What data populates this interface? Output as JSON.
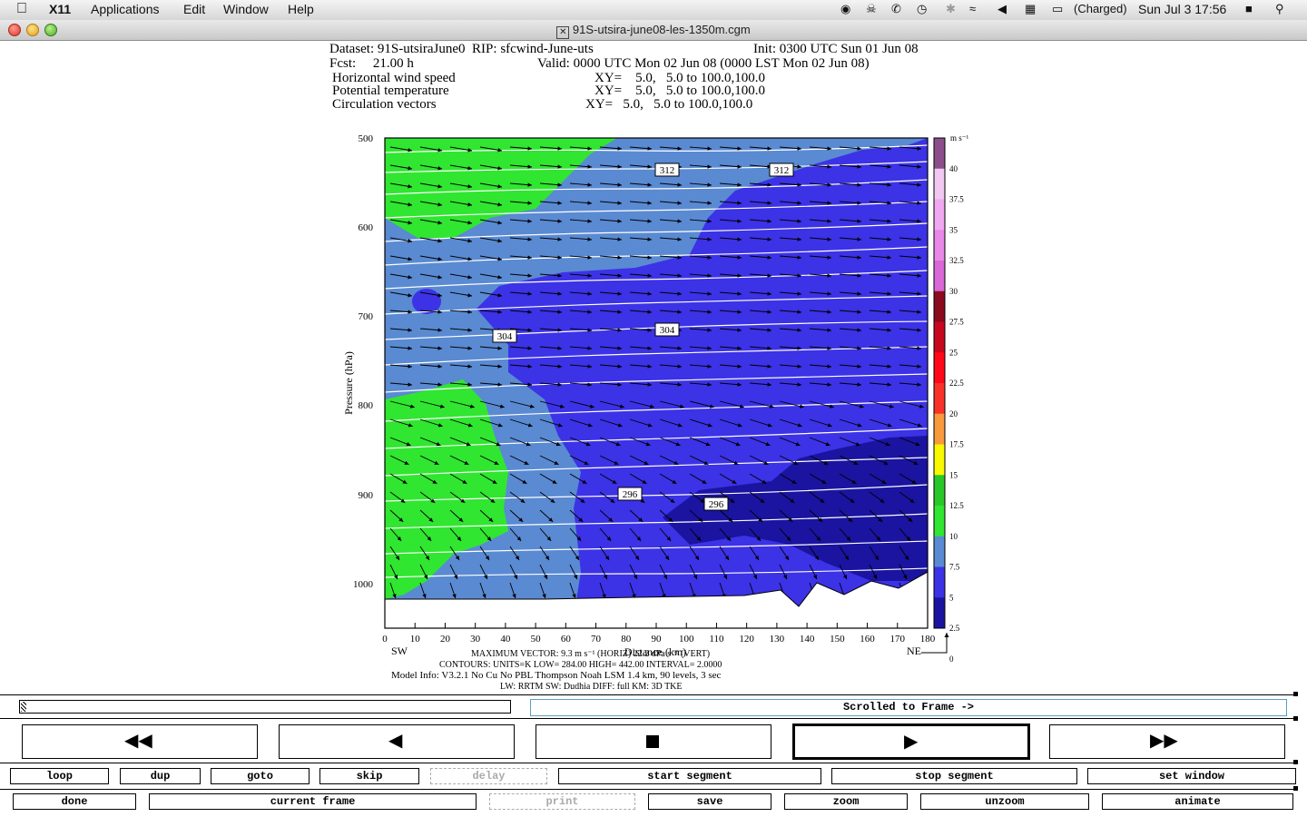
{
  "menubar": {
    "app": "X11",
    "items": [
      "Applications",
      "Edit",
      "Window",
      "Help"
    ],
    "battery": "(Charged)",
    "clock": "Sun Jul 3  17:56"
  },
  "window": {
    "title": "91S-utsira-june08-les-1350m.cgm"
  },
  "header": {
    "line1_left": "Dataset: 91S-utsiraJune0  RIP: sfcwind-June-uts",
    "line1_right": "Init: 0300 UTC Sun 01 Jun 08",
    "line2_left": "Fcst:     21.00 h",
    "line2_right": "Valid: 0000 UTC Mon 02 Jun 08 (0000 LST Mon 02 Jun 08)",
    "fields": [
      {
        "name": "Horizontal wind speed",
        "xy": "XY=    5.0,   5.0 to 100.0,100.0"
      },
      {
        "name": "Potential temperature",
        "xy": "XY=    5.0,   5.0 to 100.0,100.0"
      },
      {
        "name": "Circulation vectors",
        "xy": "XY=   5.0,   5.0 to 100.0,100.0"
      }
    ]
  },
  "plot": {
    "ylabel": "Pressure (hPa)",
    "xlabel": "Distance (km)",
    "yticks": [
      "500",
      "600",
      "700",
      "800",
      "900",
      "1000"
    ],
    "xticks": [
      "0",
      "10",
      "20",
      "30",
      "40",
      "50",
      "60",
      "70",
      "80",
      "90",
      "100",
      "110",
      "120",
      "130",
      "140",
      "150",
      "160",
      "170",
      "180"
    ],
    "left_end": "SW",
    "right_end": "NE",
    "contour_labels": [
      "312",
      "312",
      "304",
      "304",
      "296",
      "296"
    ],
    "colorbar": {
      "unit": "m s⁻¹",
      "labels": [
        "40",
        "37.5",
        "35",
        "32.5",
        "30",
        "27.5",
        "25",
        "22.5",
        "20",
        "17.5",
        "15",
        "12.5",
        "10",
        "7.5",
        "5",
        "2.5",
        "0"
      ],
      "colors": [
        "#8c4f8c",
        "#f0c8f0",
        "#f0a8f0",
        "#e888e8",
        "#d868d8",
        "#8c0a1e",
        "#c8081e",
        "#ff0818",
        "#f83228",
        "#f89a3c",
        "#f8f800",
        "#28c828",
        "#30e630",
        "#5a8ad2",
        "#3c32e6",
        "#1a14a0"
      ]
    },
    "footer": [
      "MAXIMUM VECTOR:   9.3 m s⁻¹ (HORIZ)   22.2 dPa s⁻¹ (VERT)",
      "CONTOURS:  UNITS=K  LOW=  284.00         HIGH=  442.00         INTERVAL=    2.0000",
      "Model Info: V3.2.1     No Cu     No PBL     Thompson       Noah LSM    1.4 km,   90 levels,      3 sec",
      "LW: RRTM  SW: Dudhia   DIFF: full    KM: 3D TKE"
    ]
  },
  "controls": {
    "status": "Scrolled to Frame ->",
    "row1": [
      {
        "label": "loop",
        "enabled": true
      },
      {
        "label": "dup",
        "enabled": true
      },
      {
        "label": "goto",
        "enabled": true
      },
      {
        "label": "skip",
        "enabled": true
      },
      {
        "label": "delay",
        "enabled": false
      },
      {
        "label": "start segment",
        "enabled": true
      },
      {
        "label": "stop segment",
        "enabled": true
      },
      {
        "label": "set window",
        "enabled": true
      }
    ],
    "row2": [
      {
        "label": "done",
        "enabled": true
      },
      {
        "label": "current frame",
        "enabled": true
      },
      {
        "label": "print",
        "enabled": false
      },
      {
        "label": "save",
        "enabled": true
      },
      {
        "label": "zoom",
        "enabled": true
      },
      {
        "label": "unzoom",
        "enabled": true
      },
      {
        "label": "animate",
        "enabled": true
      }
    ]
  }
}
